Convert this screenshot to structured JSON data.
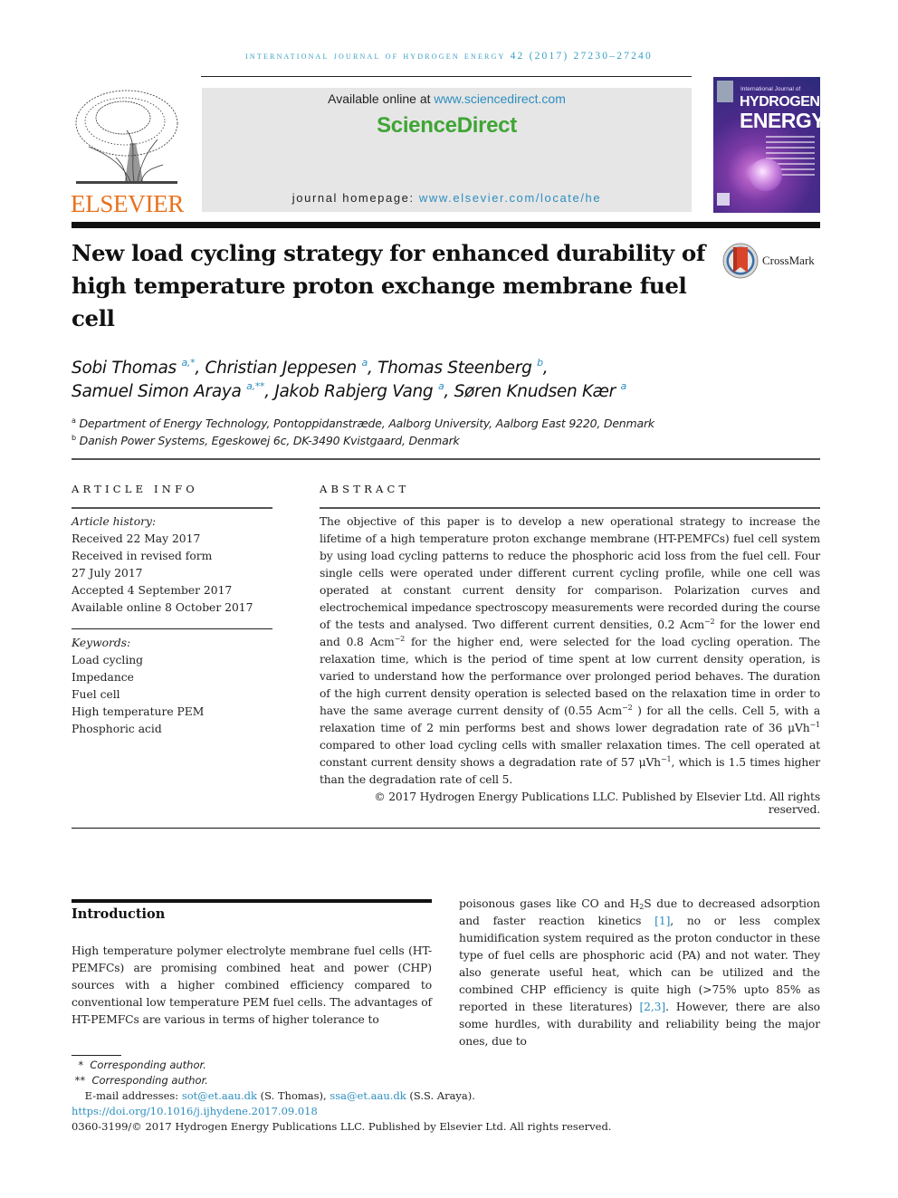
{
  "journal": {
    "running_head": "INTERNATIONAL JOURNAL OF HYDROGEN ENERGY 42 (2017) 27230–27240",
    "publisher_logo_text": "ELSEVIER",
    "available_online_prefix": "Available online at ",
    "available_online_link": "www.sciencedirect.com",
    "platform_brand": "ScienceDirect",
    "homepage_prefix": "journal homepage: ",
    "homepage_link": "www.elsevier.com/locate/he",
    "cover": {
      "subtitle": "International Journal of",
      "title_line1": "HYDROGEN",
      "title_line2": "ENERGY"
    },
    "colors": {
      "link": "#2d8dbf",
      "elsevier_orange": "#e9711c",
      "sciencedirect_green": "#3fa535"
    }
  },
  "article": {
    "title": "New load cycling strategy for enhanced durability of high temperature proton exchange membrane fuel cell",
    "crossmark_label": "CrossMark",
    "authors": [
      {
        "name": "Sobi Thomas",
        "sup": "a,*",
        "sep": ", "
      },
      {
        "name": "Christian Jeppesen",
        "sup": "a",
        "sep": ", "
      },
      {
        "name": "Thomas Steenberg",
        "sup": "b",
        "sep": ","
      },
      {
        "name": "Samuel Simon Araya",
        "sup": "a,**",
        "sep": ", "
      },
      {
        "name": "Jakob Rabjerg Vang",
        "sup": "a",
        "sep": ", "
      },
      {
        "name": "Søren Knudsen Kær",
        "sup": "a",
        "sep": ""
      }
    ],
    "affiliations": [
      {
        "sup": "a",
        "text": "Department of Energy Technology, Pontoppidanstræde, Aalborg University, Aalborg East 9220, Denmark"
      },
      {
        "sup": "b",
        "text": "Danish Power Systems, Egeskowej 6c, DK-3490 Kvistgaard, Denmark"
      }
    ]
  },
  "article_info": {
    "heading": "ARTICLE INFO",
    "history_label": "Article history:",
    "history": [
      "Received 22 May 2017",
      "Received in revised form",
      "27 July 2017",
      "Accepted 4 September 2017",
      "Available online 8 October 2017"
    ],
    "keywords_label": "Keywords:",
    "keywords": [
      "Load cycling",
      "Impedance",
      "Fuel cell",
      "High temperature PEM",
      "Phosphoric acid"
    ]
  },
  "abstract": {
    "heading": "ABSTRACT",
    "p1": "The objective of this paper is to develop a new operational strategy to increase the lifetime of a high temperature proton exchange membrane (HT-PEMFCs) fuel cell system by using load cycling patterns to reduce the phosphoric acid loss from the fuel cell. Four single cells were operated under different current cycling profile, while one cell was operated at constant current density for comparison. Polarization curves and electrochemical impedance spectroscopy measurements were recorded during the course of the tests and analysed. Two different current densities, 0.2 Acm",
    "sup1": "−2",
    "p2": " for the lower end and 0.8 Acm",
    "sup2": "−2",
    "p3": " for the higher end, were selected for the load cycling operation. The relaxation time, which is the period of time spent at low current density operation, is varied to understand how the performance over prolonged period behaves. The duration of the high current density operation is selected based on the relaxation time in order to have the same average current density of (0.55 Acm",
    "sup3": "−2",
    "p4": " ) for all the cells. Cell 5, with a relaxation time of 2 min performs best and shows lower degradation rate of 36 μVh",
    "sup4": "−1",
    "p5": " compared to other load cycling cells with smaller relaxation times. The cell operated at constant current density shows a degradation rate of 57 μVh",
    "sup5": "−1",
    "p6": ", which is 1.5 times higher than the degradation rate of cell 5.",
    "copyright": "© 2017 Hydrogen Energy Publications LLC. Published by Elsevier Ltd. All rights reserved."
  },
  "introduction": {
    "heading": "Introduction",
    "left_text": "High temperature polymer electrolyte membrane fuel cells (HT-PEMFCs) are promising combined heat and power (CHP) sources with a higher combined efficiency compared to conventional low temperature PEM fuel cells. The advantages of HT-PEMFCs are various in terms of higher tolerance to",
    "right_a": "poisonous gases like CO and H",
    "right_sub": "2",
    "right_b": "S due to decreased adsorption and faster reaction kinetics ",
    "ref1": "[1]",
    "right_c": ", no or less complex humidification system required as the proton conductor in these type of fuel cells are phosphoric acid (PA) and not water. They also generate useful heat, which can be utilized and the combined CHP efficiency is quite high (>75% upto 85% as reported in these literatures) ",
    "ref2": "[2,3]",
    "right_d": ". However, there are also some hurdles, with durability and reliability being the major ones, due to"
  },
  "footnotes": {
    "corr1_mark": "*",
    "corr1_text": "Corresponding author.",
    "corr2_mark": "**",
    "corr2_text": "Corresponding author.",
    "email_prefix": "E-mail addresses: ",
    "email1": "sot@et.aau.dk",
    "email1_owner": " (S. Thomas), ",
    "email2": "ssa@et.aau.dk",
    "email2_owner": " (S.S. Araya).",
    "doi": "https://doi.org/10.1016/j.ijhydene.2017.09.018",
    "issn_copyright": "0360-3199/© 2017 Hydrogen Energy Publications LLC. Published by Elsevier Ltd. All rights reserved."
  }
}
